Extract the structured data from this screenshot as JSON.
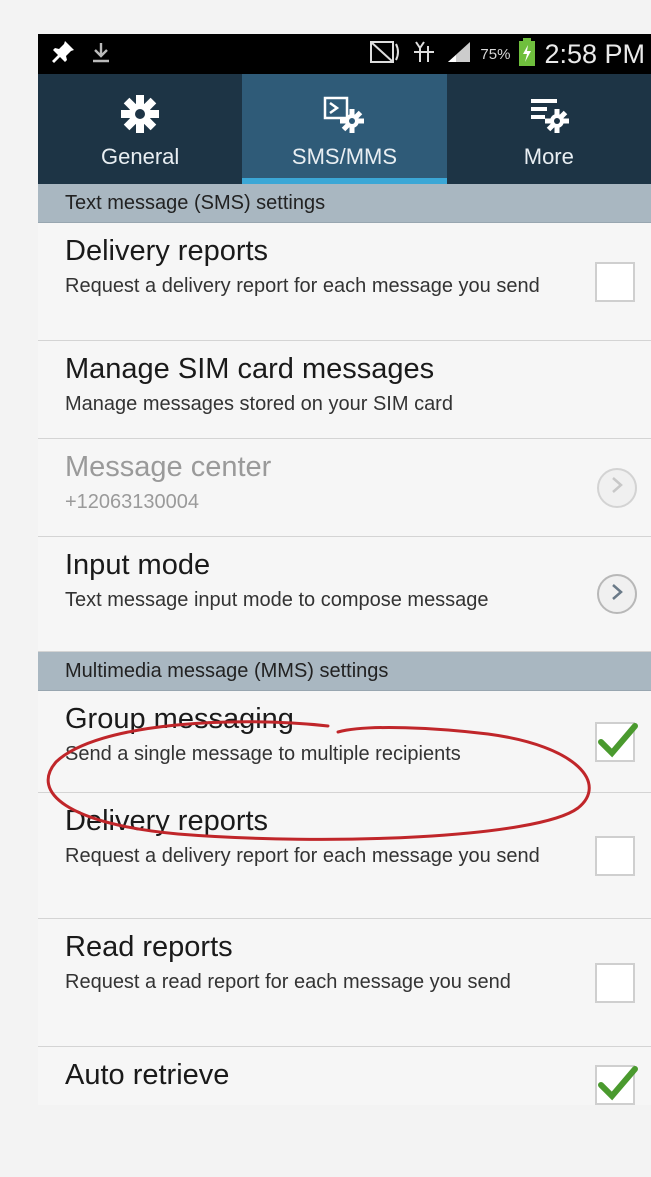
{
  "status_bar": {
    "battery_percent": "75%",
    "time": "2:58 PM"
  },
  "tabs": [
    {
      "label": "General",
      "icon": "gear-icon",
      "active": false
    },
    {
      "label": "SMS/MMS",
      "icon": "sms-gear-icon",
      "active": true
    },
    {
      "label": "More",
      "icon": "list-gear-icon",
      "active": false
    }
  ],
  "sms_section": {
    "header": "Text message (SMS) settings",
    "items": [
      {
        "title": "Delivery reports",
        "subtitle": "Request a delivery report for each message you send",
        "control": "checkbox",
        "checked": false
      },
      {
        "title": "Manage SIM card messages",
        "subtitle": "Manage messages stored on your SIM card",
        "control": "none"
      },
      {
        "title": "Message center",
        "subtitle": "+12063130004",
        "control": "chevron",
        "disabled": true
      },
      {
        "title": "Input mode",
        "subtitle": "Text message input mode to compose message",
        "control": "chevron"
      }
    ]
  },
  "mms_section": {
    "header": "Multimedia message (MMS) settings",
    "items": [
      {
        "title": "Group messaging",
        "subtitle": "Send a single message to multiple recipients",
        "control": "checkbox",
        "checked": true
      },
      {
        "title": "Delivery reports",
        "subtitle": "Request a delivery report for each message you send",
        "control": "checkbox",
        "checked": false
      },
      {
        "title": "Read reports",
        "subtitle": "Request a read report for each message you send",
        "control": "checkbox",
        "checked": false
      },
      {
        "title": "Auto retrieve",
        "subtitle": "",
        "control": "checkbox",
        "checked": true
      }
    ]
  },
  "colors": {
    "tab_bar": "#1d3445",
    "tab_active": "#2f5b78",
    "tab_indicator": "#3ba7d6",
    "section_header": "#a9b7c1",
    "check_green": "#4a9a2e",
    "annotation_red": "#c0262a"
  }
}
